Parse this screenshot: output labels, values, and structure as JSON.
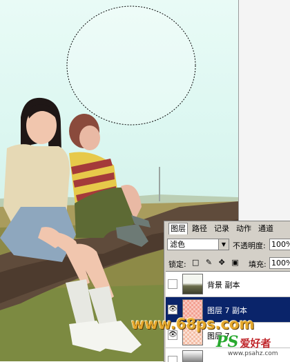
{
  "panel": {
    "tabs": [
      "图层",
      "路径",
      "记录",
      "动作",
      "通道"
    ],
    "active_tab": "图层",
    "blend_mode": "滤色",
    "opacity_label": "不透明度:",
    "opacity_value": "100%",
    "lock_label": "锁定:",
    "lock_icons": "□ ✎ ✥ ▣",
    "fill_label": "填充:",
    "fill_value": "100%",
    "layers": [
      {
        "name": "背景 副本",
        "visible": false,
        "selected": false
      },
      {
        "name": "图层 7 副本",
        "visible": true,
        "selected": true
      },
      {
        "name": "图层 7",
        "visible": true,
        "selected": false
      },
      {
        "name": "",
        "visible": false,
        "selected": false
      }
    ],
    "eye_glyph": "👁"
  },
  "watermark": {
    "site": "www.68ps.com",
    "logo_ps": "PS",
    "logo_cn": "爱好者",
    "url": "www.psahz.com"
  },
  "colors": {
    "sky": "#e0f8f3",
    "selection_bg": "#0a246a",
    "panel_bg": "#d4d0c8",
    "watermark_orange": "#e4a72b",
    "logo_green": "#27a82e",
    "logo_red": "#c0262b"
  }
}
